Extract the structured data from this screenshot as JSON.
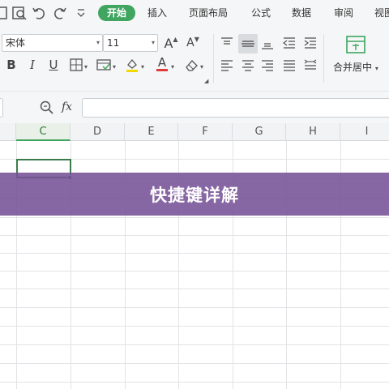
{
  "menubar": {
    "quick_icons": [
      "toolbar-icon",
      "find-in-doc-icon",
      "undo-icon",
      "redo-icon",
      "more-dropdown-icon"
    ],
    "tabs": [
      {
        "label": "开始",
        "active": true
      },
      {
        "label": "插入"
      },
      {
        "label": "页面布局"
      },
      {
        "label": "公式"
      },
      {
        "label": "数据"
      },
      {
        "label": "审阅"
      },
      {
        "label": "视图"
      }
    ]
  },
  "ribbon": {
    "font_name": "宋体",
    "font_size": "11",
    "increase_font_label": "A",
    "decrease_font_label": "A",
    "bold_label": "B",
    "italic_label": "I",
    "underline_label": "U",
    "font_color_label": "A",
    "font_color": "#e03a3a",
    "fill_color": "#f5d800",
    "merge_label": "合并居中"
  },
  "formula_bar": {
    "fx_label": "fx",
    "value": ""
  },
  "columns": {
    "labels": [
      "C",
      "D",
      "E",
      "F",
      "G",
      "H",
      "I"
    ],
    "active": "C"
  },
  "banner": {
    "text": "快捷键详解",
    "background": "#765296"
  },
  "colors": {
    "accent": "#3fa55f"
  }
}
